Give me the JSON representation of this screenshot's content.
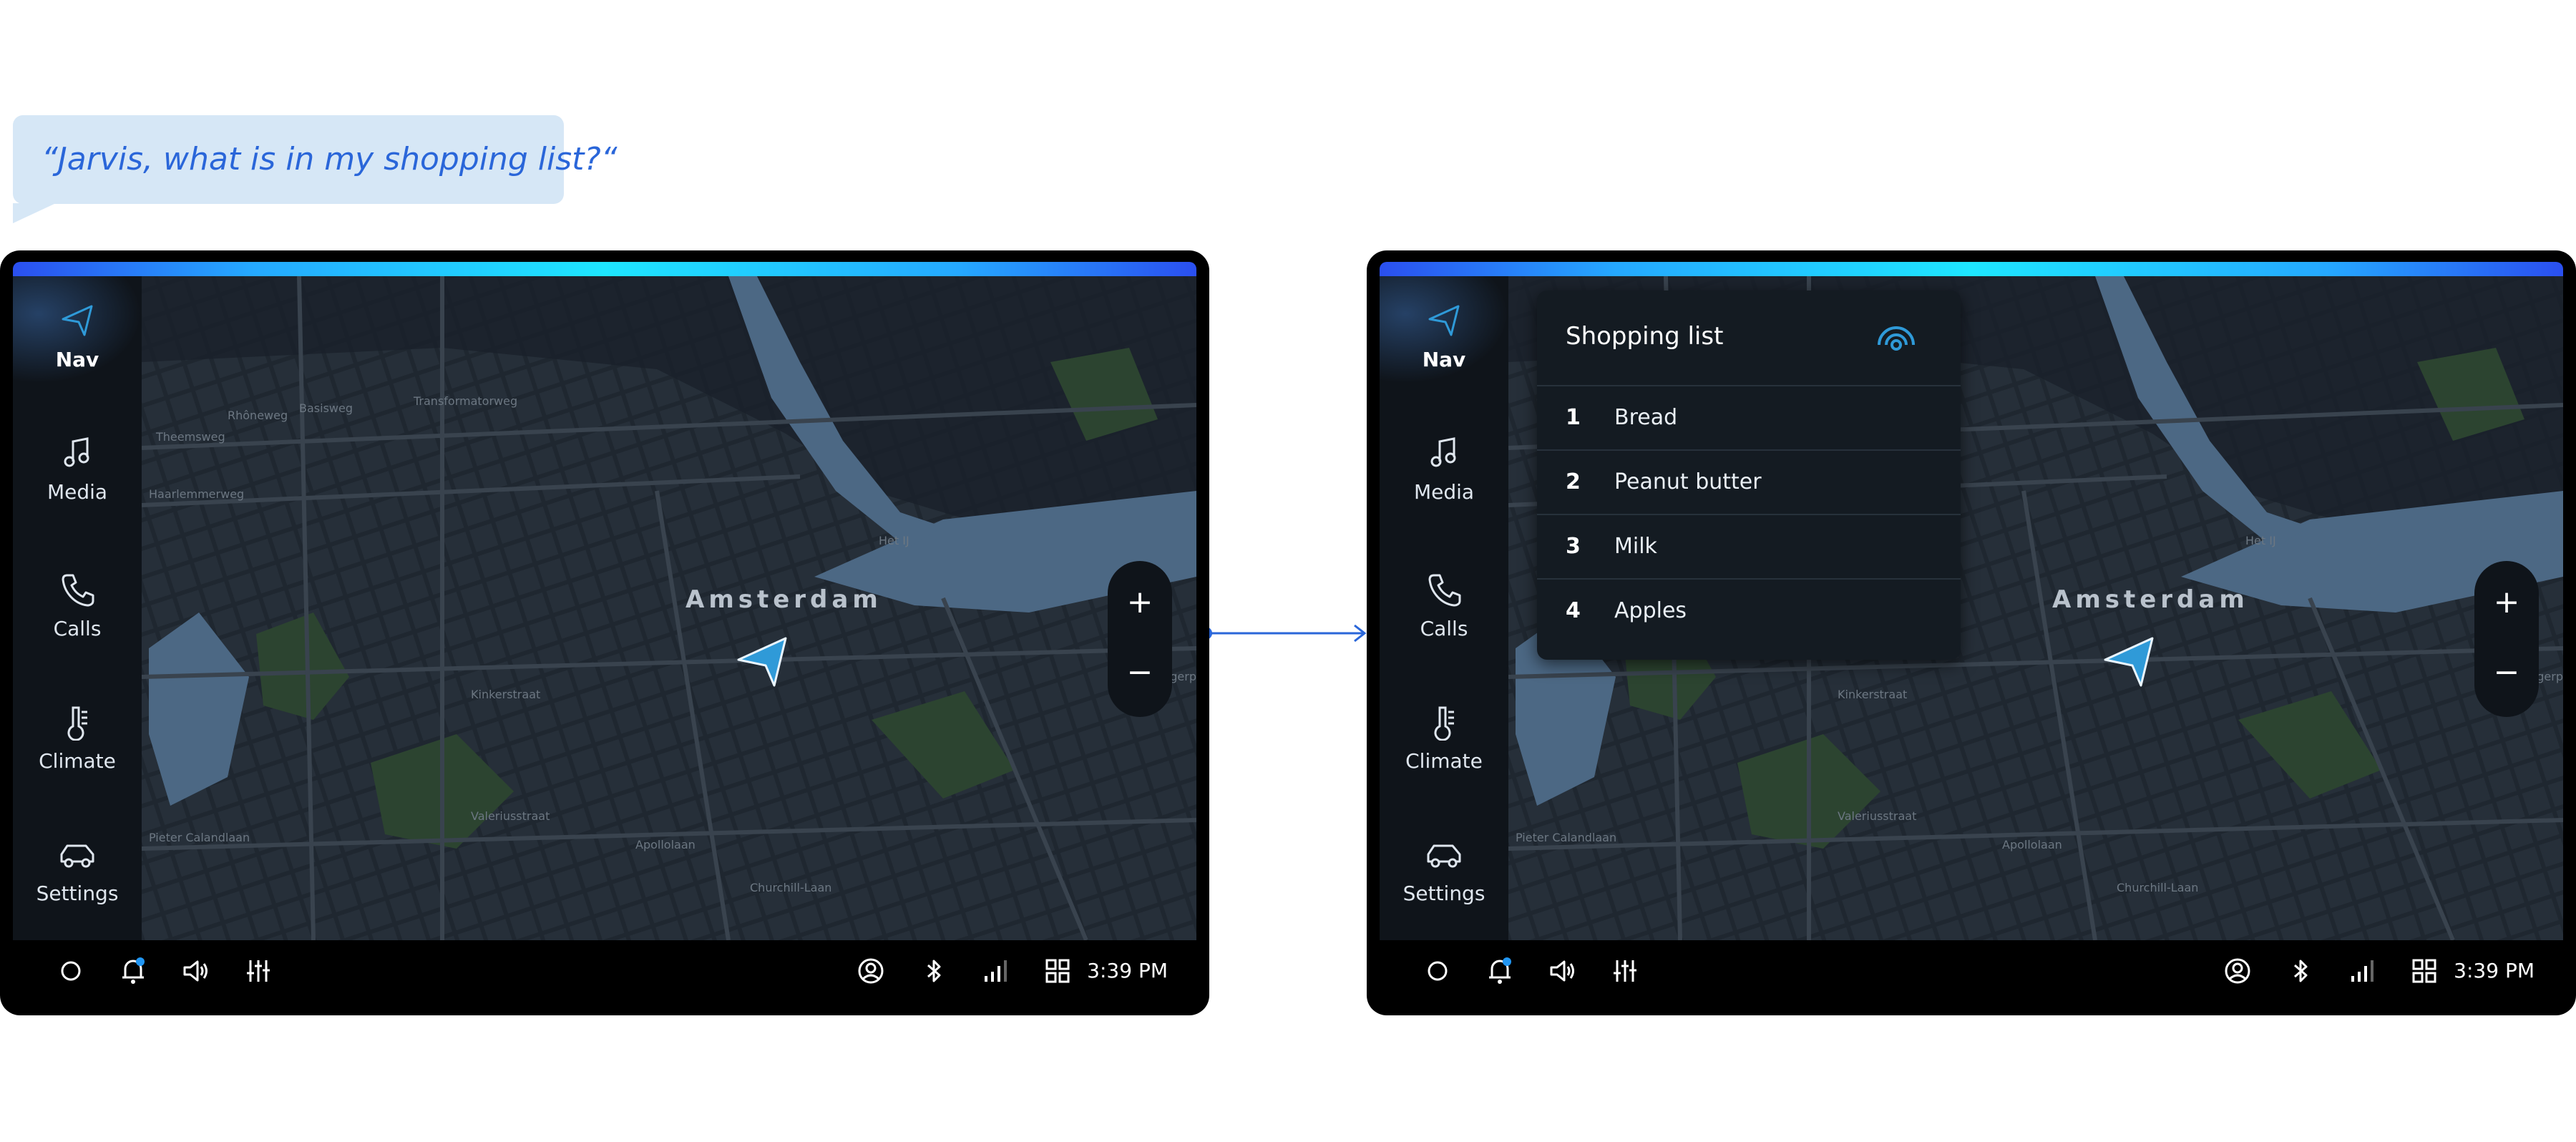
{
  "voice_prompt": "“Jarvis, what is in my shopping list?“",
  "screens": [
    {
      "sidebar": [
        {
          "label": "Nav",
          "icon": "navigation-arrow-icon",
          "active": true
        },
        {
          "label": "Media",
          "icon": "music-note-icon",
          "active": false
        },
        {
          "label": "Calls",
          "icon": "phone-icon",
          "active": false
        },
        {
          "label": "Climate",
          "icon": "thermometer-icon",
          "active": false
        },
        {
          "label": "Settings",
          "icon": "car-icon",
          "active": false
        }
      ],
      "map": {
        "city_label": "Amsterdam",
        "zoom_in": "+",
        "zoom_out": "−"
      },
      "time": "3:39 PM"
    },
    {
      "sidebar": [
        {
          "label": "Nav",
          "icon": "navigation-arrow-icon",
          "active": true
        },
        {
          "label": "Media",
          "icon": "music-note-icon",
          "active": false
        },
        {
          "label": "Calls",
          "icon": "phone-icon",
          "active": false
        },
        {
          "label": "Climate",
          "icon": "thermometer-icon",
          "active": false
        },
        {
          "label": "Settings",
          "icon": "car-icon",
          "active": false
        }
      ],
      "map": {
        "city_label": "Amsterdam",
        "zoom_in": "+",
        "zoom_out": "−"
      },
      "time": "3:39 PM",
      "shopping_list": {
        "title": "Shopping list",
        "icon": "voice-listening-icon",
        "items": [
          {
            "num": "1",
            "text": "Bread"
          },
          {
            "num": "2",
            "text": "Peanut butter"
          },
          {
            "num": "3",
            "text": "Milk"
          },
          {
            "num": "4",
            "text": "Apples"
          }
        ]
      }
    }
  ],
  "map_street_labels": [
    "Transformatorweg",
    "Basisweg",
    "Rhôneweg",
    "Theemsweg",
    "Haarlemmerweg",
    "Het IJ",
    "Zeeburgerpad",
    "Kinkerstraat",
    "Valeriusstraat",
    "Apollolaan",
    "Churchill-Laan",
    "Pieter Calandlaan"
  ],
  "colors": {
    "accent": "#2f9ad8",
    "glow_start": "#2a4ff0",
    "glow_mid": "#1ee6ff",
    "bubble_bg": "#d6e7f6",
    "bubble_text": "#2a66d9",
    "notification_dot": "#2196f3"
  },
  "bottom_bar_icons": [
    "home-circle-icon",
    "bell-icon",
    "volume-icon",
    "equalizer-icon",
    "profile-icon",
    "bluetooth-icon",
    "signal-icon",
    "grid-icon"
  ]
}
